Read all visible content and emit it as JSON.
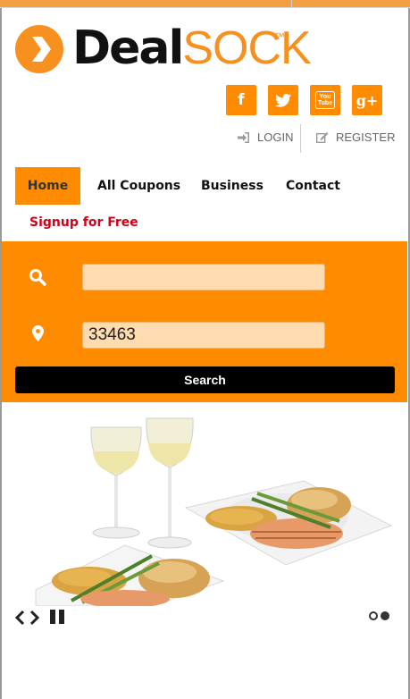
{
  "brand": {
    "name_part1": "Deal",
    "name_part2": "SOCK",
    "trademark": "™"
  },
  "colors": {
    "accent": "#ff8c00",
    "signup": "#d0021b",
    "button": "#000000",
    "field": "#fedcb0"
  },
  "social": [
    {
      "name": "facebook-icon",
      "glyph": "f"
    },
    {
      "name": "twitter-icon",
      "glyph": ""
    },
    {
      "name": "youtube-icon",
      "glyph": "You Tube"
    },
    {
      "name": "google-plus-icon",
      "glyph": "g+"
    }
  ],
  "auth": {
    "login": "LOGIN",
    "register": "REGISTER"
  },
  "nav": {
    "home": "Home",
    "coupons": "All Coupons",
    "business": "Business",
    "contact": "Contact",
    "signup": "Signup for Free",
    "active": "Home"
  },
  "search": {
    "keyword_value": "",
    "location_value": "33463",
    "button_label": "Search"
  },
  "slider": {
    "slide_count": 2,
    "active_slide": 2
  }
}
